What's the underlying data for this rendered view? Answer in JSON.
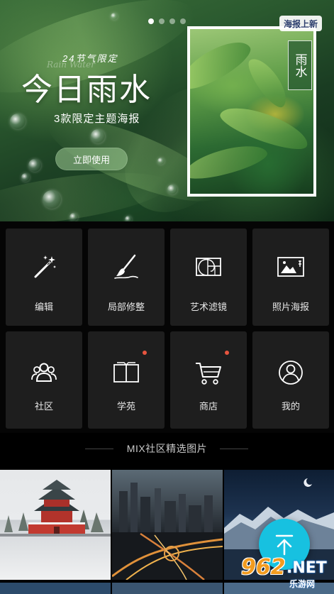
{
  "banner": {
    "subtitle": "24节气限定",
    "script_text": "Rain Water",
    "title": "今日雨水",
    "description": "3款限定主题海报",
    "cta_label": "立即使用",
    "badge": "海报上新",
    "poster_seal": "雨水",
    "carousel": {
      "count": 4,
      "active_index": 0
    }
  },
  "tools": [
    {
      "label": "编辑",
      "icon": "magic-wand-icon"
    },
    {
      "label": "局部修整",
      "icon": "brush-icon"
    },
    {
      "label": "艺术滤镜",
      "icon": "golden-ratio-icon"
    },
    {
      "label": "照片海报",
      "icon": "photo-poster-icon"
    },
    {
      "label": "社区",
      "icon": "community-icon",
      "new_dot": false
    },
    {
      "label": "学苑",
      "icon": "book-icon",
      "new_dot": true
    },
    {
      "label": "商店",
      "icon": "cart-icon",
      "new_dot": true
    },
    {
      "label": "我的",
      "icon": "profile-icon",
      "new_dot": false
    }
  ],
  "community": {
    "section_title": "MIX社区精选图片"
  },
  "watermark": {
    "number": "962",
    "domain": ".NET",
    "sub": "乐游网"
  },
  "colors": {
    "accent": "#17c1e0",
    "red_dot": "#e8553f",
    "tile_bg": "#1e1e1e"
  }
}
